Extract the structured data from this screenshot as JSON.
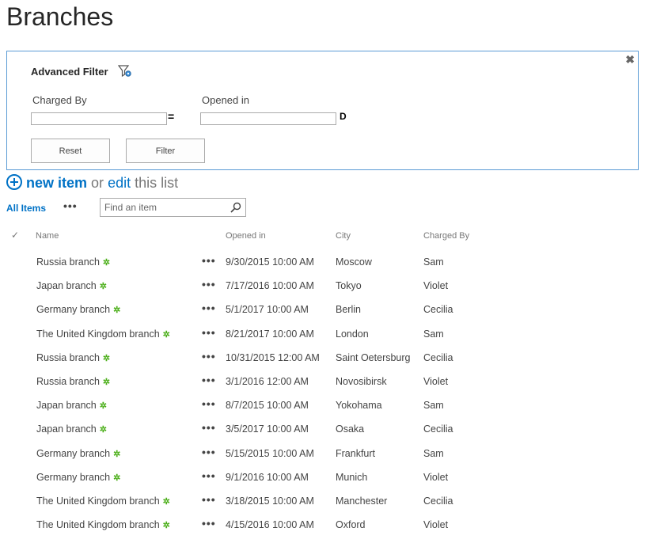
{
  "page": {
    "title": "Branches"
  },
  "filter": {
    "title": "Advanced Filter",
    "close_glyph": "✖",
    "fields": [
      {
        "label": "Charged By",
        "value": "",
        "operator": "="
      },
      {
        "label": "Opened in",
        "value": "",
        "operator": "D"
      }
    ],
    "reset_label": "Reset",
    "filter_label": "Filter"
  },
  "actions": {
    "new_item": "new item",
    "or": "or",
    "edit": "edit",
    "this_list": "this list"
  },
  "views": {
    "all_items": "All Items",
    "more": "•••",
    "search_placeholder": "Find an item"
  },
  "table": {
    "check_glyph": "✓",
    "row_menu": "•••",
    "new_badge": "✲",
    "headers": {
      "name": "Name",
      "opened_in": "Opened in",
      "city": "City",
      "charged_by": "Charged By"
    },
    "rows": [
      {
        "name": "Russia branch",
        "opened_in": "9/30/2015 10:00 AM",
        "city": "Moscow",
        "charged_by": "Sam"
      },
      {
        "name": "Japan branch",
        "opened_in": "7/17/2016 10:00 AM",
        "city": "Tokyo",
        "charged_by": "Violet"
      },
      {
        "name": "Germany branch",
        "opened_in": "5/1/2017 10:00 AM",
        "city": "Berlin",
        "charged_by": "Cecilia"
      },
      {
        "name": "The United Kingdom branch",
        "opened_in": "8/21/2017 10:00 AM",
        "city": "London",
        "charged_by": "Sam"
      },
      {
        "name": "Russia branch",
        "opened_in": "10/31/2015 12:00 AM",
        "city": "Saint Oetersburg",
        "charged_by": "Cecilia"
      },
      {
        "name": "Russia branch",
        "opened_in": "3/1/2016 12:00 AM",
        "city": "Novosibirsk",
        "charged_by": "Violet"
      },
      {
        "name": "Japan branch",
        "opened_in": "8/7/2015 10:00 AM",
        "city": "Yokohama",
        "charged_by": "Sam"
      },
      {
        "name": "Japan branch",
        "opened_in": "3/5/2017 10:00 AM",
        "city": "Osaka",
        "charged_by": "Cecilia"
      },
      {
        "name": "Germany branch",
        "opened_in": "5/15/2015 10:00 AM",
        "city": "Frankfurt",
        "charged_by": "Sam"
      },
      {
        "name": "Germany branch",
        "opened_in": "9/1/2016 10:00 AM",
        "city": "Munich",
        "charged_by": "Violet"
      },
      {
        "name": "The United Kingdom branch",
        "opened_in": "3/18/2015 10:00 AM",
        "city": "Manchester",
        "charged_by": "Cecilia"
      },
      {
        "name": "The United Kingdom branch",
        "opened_in": "4/15/2016 10:00 AM",
        "city": "Oxford",
        "charged_by": "Violet"
      }
    ]
  },
  "colors": {
    "accent": "#0072c6",
    "new_badge": "#4caf1a",
    "panel_border": "#5b9bd5"
  }
}
